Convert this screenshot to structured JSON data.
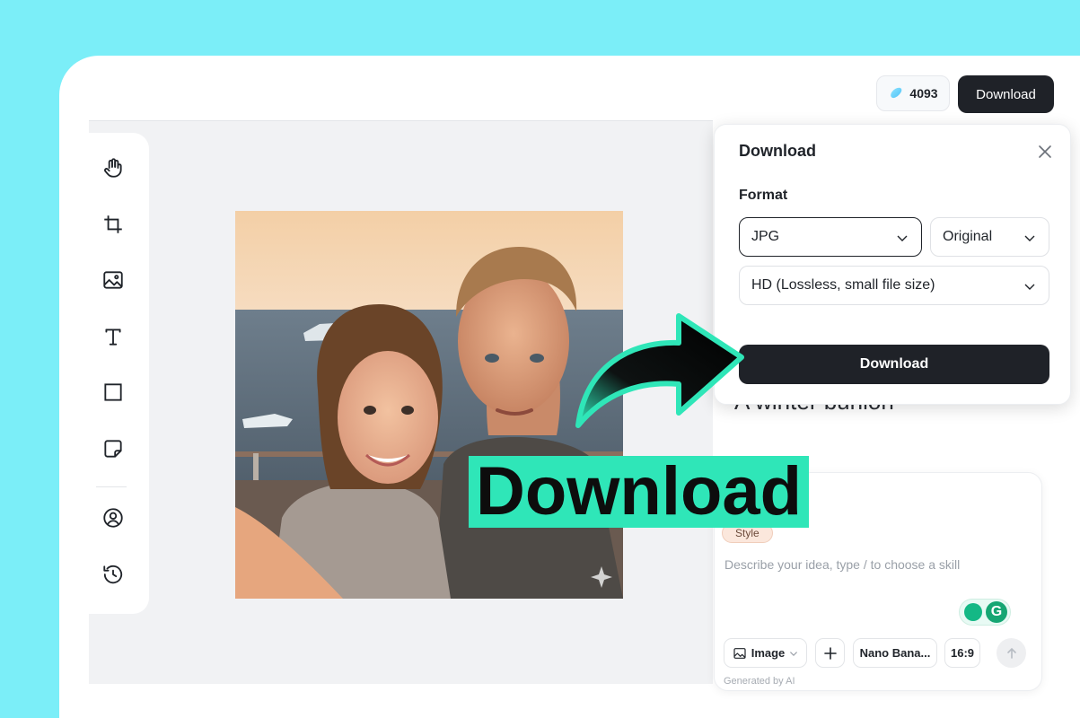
{
  "topbar": {
    "credits": "4093",
    "download_label": "Download"
  },
  "toolbar": {
    "tools": [
      "hand-icon",
      "crop-icon",
      "image-icon",
      "text-icon",
      "shape-icon",
      "sticky-note-icon",
      "avatar-icon",
      "history-icon"
    ]
  },
  "dialog": {
    "title": "Download",
    "format_label": "Format",
    "format_value": "JPG",
    "size_value": "Original",
    "quality_value": "HD (Lossless, small file size)",
    "download_label": "Download"
  },
  "background_text": "A winter bunion",
  "prompt": {
    "style_chip": "Style",
    "placeholder": "Describe your idea, type / to choose a skill",
    "image_label": "Image",
    "model_label": "Nano Bana...",
    "ratio_label": "16:9",
    "generated_by": "Generated by AI"
  },
  "overlay": {
    "headline": "Download"
  },
  "colors": {
    "accent": "#2fe6b8",
    "background": "#7beef8",
    "dark_button": "#1f2228"
  }
}
